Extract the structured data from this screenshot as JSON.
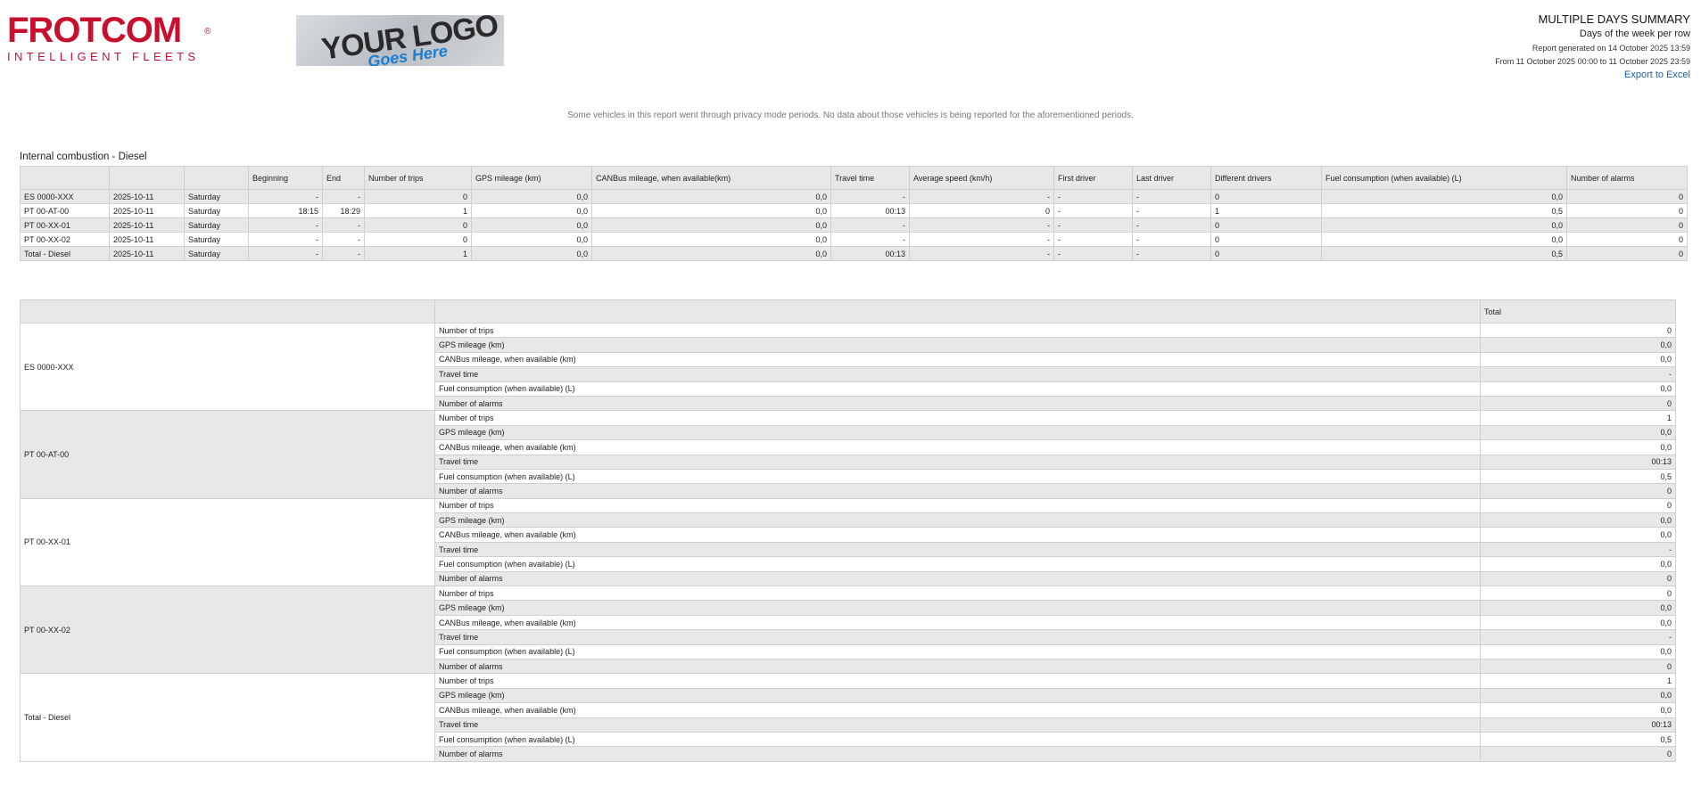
{
  "brand": {
    "name": "FROTCOM",
    "registered": "®",
    "tagline": "INTELLIGENT FLEETS"
  },
  "custom_logo": {
    "line1": "YOUR LOGO",
    "line2": "Goes Here"
  },
  "report": {
    "title": "MULTIPLE DAYS SUMMARY",
    "subtitle": "Days of the week per row",
    "generated": "Report generated on 14 October 2025 13:59",
    "period": "From 11 October 2025 00:00 to 11 October 2025 23:59",
    "export_label": "Export to Excel"
  },
  "privacy_note": "Some vehicles in this report went through privacy mode periods. No data about those vehicles is being reported for the aforementioned periods.",
  "section_title": "Internal combustion - Diesel",
  "summary": {
    "headers": [
      "",
      "",
      "",
      "Beginning",
      "End",
      "Number of trips",
      "GPS mileage (km)",
      "CANBus mileage, when available(km)",
      "Travel time",
      "Average speed (km/h)",
      "First driver",
      "Last driver",
      "Different drivers",
      "Fuel consumption (when available) (L)",
      "Number of alarms"
    ],
    "rows": [
      [
        "ES 0000-XXX",
        "2025-10-11",
        "Saturday",
        "-",
        "-",
        "0",
        "0,0",
        "0,0",
        "-",
        "-",
        "-",
        "-",
        "0",
        "0,0",
        "0"
      ],
      [
        "PT 00-AT-00",
        "2025-10-11",
        "Saturday",
        "18:15",
        "18:29",
        "1",
        "0,0",
        "0,0",
        "00:13",
        "0",
        "-",
        "-",
        "1",
        "0,5",
        "0"
      ],
      [
        "PT 00-XX-01",
        "2025-10-11",
        "Saturday",
        "-",
        "-",
        "0",
        "0,0",
        "0,0",
        "-",
        "-",
        "-",
        "-",
        "0",
        "0,0",
        "0"
      ],
      [
        "PT 00-XX-02",
        "2025-10-11",
        "Saturday",
        "-",
        "-",
        "0",
        "0,0",
        "0,0",
        "-",
        "-",
        "-",
        "-",
        "0",
        "0,0",
        "0"
      ],
      [
        "Total - Diesel",
        "2025-10-11",
        "Saturday",
        "-",
        "-",
        "1",
        "0,0",
        "0,0",
        "00:13",
        "-",
        "-",
        "-",
        "0",
        "0,5",
        "0"
      ]
    ]
  },
  "pivot": {
    "total_header": "Total",
    "metrics": [
      "Number of trips",
      "GPS mileage (km)",
      "CANBus mileage, when available (km)",
      "Travel time",
      "Fuel consumption (when available) (L)",
      "Number of alarms"
    ],
    "vehicles": [
      {
        "name": "ES 0000-XXX",
        "values": [
          "0",
          "0,0",
          "0,0",
          "-",
          "0,0",
          "0"
        ]
      },
      {
        "name": "PT 00-AT-00",
        "values": [
          "1",
          "0,0",
          "0,0",
          "00:13",
          "0,5",
          "0"
        ]
      },
      {
        "name": "PT 00-XX-01",
        "values": [
          "0",
          "0,0",
          "0,0",
          "-",
          "0,0",
          "0"
        ]
      },
      {
        "name": "PT 00-XX-02",
        "values": [
          "0",
          "0,0",
          "0,0",
          "-",
          "0,0",
          "0"
        ]
      },
      {
        "name": "Total - Diesel",
        "values": [
          "1",
          "0,0",
          "0,0",
          "00:13",
          "0,5",
          "0"
        ]
      }
    ]
  }
}
